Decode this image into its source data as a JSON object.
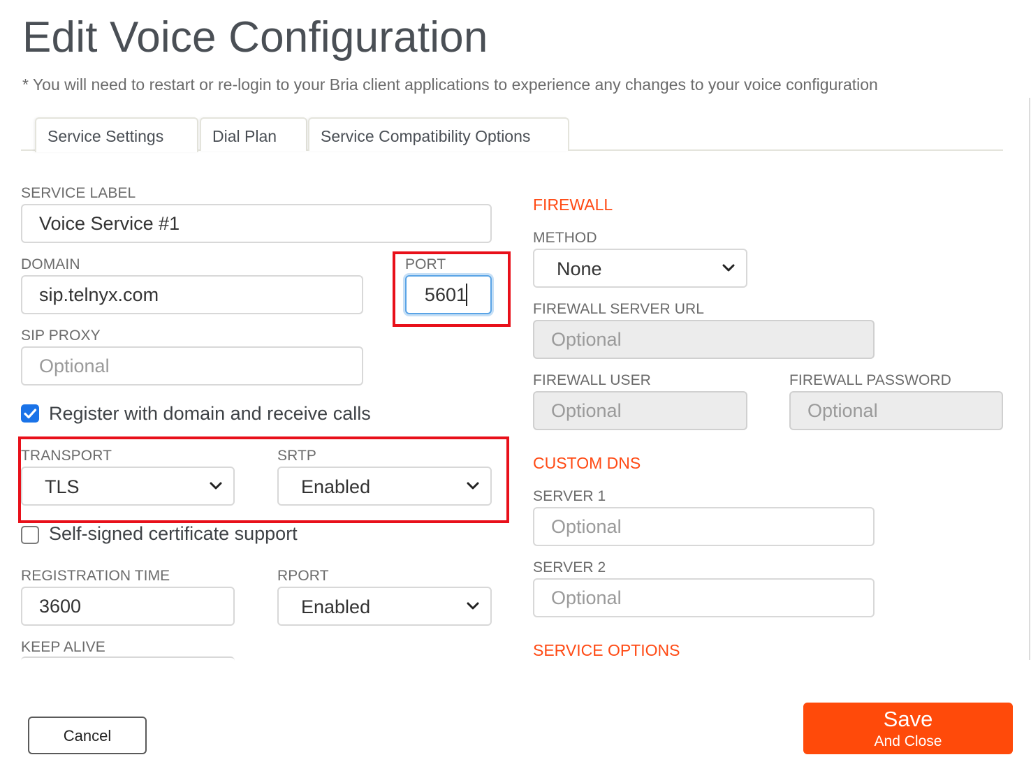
{
  "header": {
    "title": "Edit Voice Configuration",
    "note": "* You will need to restart or re-login to your Bria client applications to experience any changes to your voice configuration"
  },
  "tabs": [
    {
      "label": "Service Settings",
      "active": true
    },
    {
      "label": "Dial Plan",
      "active": false
    },
    {
      "label": "Service Compatibility Options",
      "active": false
    }
  ],
  "left": {
    "service_label": {
      "label": "SERVICE LABEL",
      "value": "Voice Service #1"
    },
    "domain": {
      "label": "DOMAIN",
      "value": "sip.telnyx.com"
    },
    "port": {
      "label": "PORT",
      "value": "5601"
    },
    "sip_proxy": {
      "label": "SIP PROXY",
      "placeholder": "Optional"
    },
    "register": {
      "label": "Register with domain and receive calls",
      "checked": true
    },
    "transport": {
      "label": "TRANSPORT",
      "value": "TLS"
    },
    "srtp": {
      "label": "SRTP",
      "value": "Enabled"
    },
    "self_signed": {
      "label": "Self-signed certificate support",
      "checked": false
    },
    "registration_time": {
      "label": "REGISTRATION TIME",
      "value": "3600"
    },
    "rport": {
      "label": "RPORT",
      "value": "Enabled"
    },
    "keep_alive": {
      "label": "KEEP ALIVE"
    }
  },
  "right": {
    "firewall_heading": "FIREWALL",
    "method": {
      "label": "METHOD",
      "value": "None"
    },
    "firewall_server_url": {
      "label": "FIREWALL SERVER URL",
      "placeholder": "Optional"
    },
    "firewall_user": {
      "label": "FIREWALL USER",
      "placeholder": "Optional"
    },
    "firewall_password": {
      "label": "FIREWALL PASSWORD",
      "placeholder": "Optional"
    },
    "custom_dns_heading": "CUSTOM DNS",
    "server1": {
      "label": "SERVER 1",
      "placeholder": "Optional"
    },
    "server2": {
      "label": "SERVER 2",
      "placeholder": "Optional"
    },
    "service_options_heading": "SERVICE OPTIONS"
  },
  "footer": {
    "cancel_label": "Cancel",
    "save_label": "Save",
    "save_sublabel": "And Close"
  },
  "colors": {
    "accent": "#ff4a0a",
    "highlight": "#e8101a",
    "checkbox": "#1a73e8",
    "focus": "#5aa4e6"
  },
  "icons": [
    "chevron-down-icon",
    "checkmark-icon"
  ]
}
